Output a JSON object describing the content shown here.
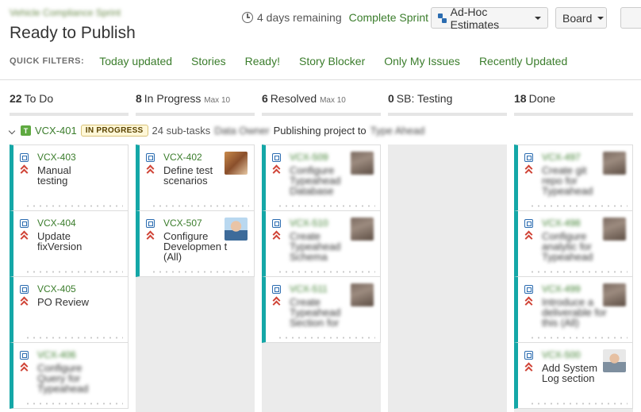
{
  "header": {
    "project_name": "Vehicle Compliance Sprint",
    "title": "Ready to Publish",
    "remaining": "4 days remaining",
    "complete_sprint": "Complete Sprint",
    "estimate_button": "Ad-Hoc Estimates",
    "board_button": "Board"
  },
  "quick_filters": {
    "label": "QUICK FILTERS:",
    "items": [
      "Today updated",
      "Stories",
      "Ready!",
      "Story Blocker",
      "Only My Issues",
      "Recently Updated"
    ]
  },
  "columns": [
    {
      "count": "22",
      "name": "To Do",
      "max": ""
    },
    {
      "count": "8",
      "name": "In Progress",
      "max": "Max 10"
    },
    {
      "count": "6",
      "name": "Resolved",
      "max": "Max 10"
    },
    {
      "count": "0",
      "name": "SB: Testing",
      "max": ""
    },
    {
      "count": "18",
      "name": "Done",
      "max": ""
    }
  ],
  "swimlane": {
    "key": "VCX-401",
    "status": "IN PROGRESS",
    "subtasks": "24 sub-tasks",
    "owner": "Data Owner",
    "summary": "Publishing project to",
    "summary_tail": "Type Ahead"
  },
  "cards": {
    "todo": [
      {
        "key": "VCX-403",
        "summary": "Manual testing"
      },
      {
        "key": "VCX-404",
        "summary": "Update fixVersion"
      },
      {
        "key": "VCX-405",
        "summary": "PO Review"
      },
      {
        "key": "VCX-406",
        "summary": "Configure Query for Typeahead"
      }
    ],
    "in_progress": [
      {
        "key": "VCX-402",
        "summary": "Define test scenarios"
      },
      {
        "key": "VCX-507",
        "summary": "Configure Developmen t (All)"
      }
    ],
    "resolved": [
      {
        "key": "VCX-509",
        "summary": "Configure Typeahead Database"
      },
      {
        "key": "VCX-510",
        "summary": "Create Typeahead Schema"
      },
      {
        "key": "VCX-511",
        "summary": "Create Typeahead Section for"
      }
    ],
    "done": [
      {
        "key": "VCX-497",
        "summary": "Create git repo for Typeahead"
      },
      {
        "key": "VCX-498",
        "summary": "Configure analytic for Typeahead"
      },
      {
        "key": "VCX-499",
        "summary": "Introduce a deliverable for this (All)"
      },
      {
        "key": "VCX-500",
        "summary": "Add System Log section"
      }
    ]
  }
}
